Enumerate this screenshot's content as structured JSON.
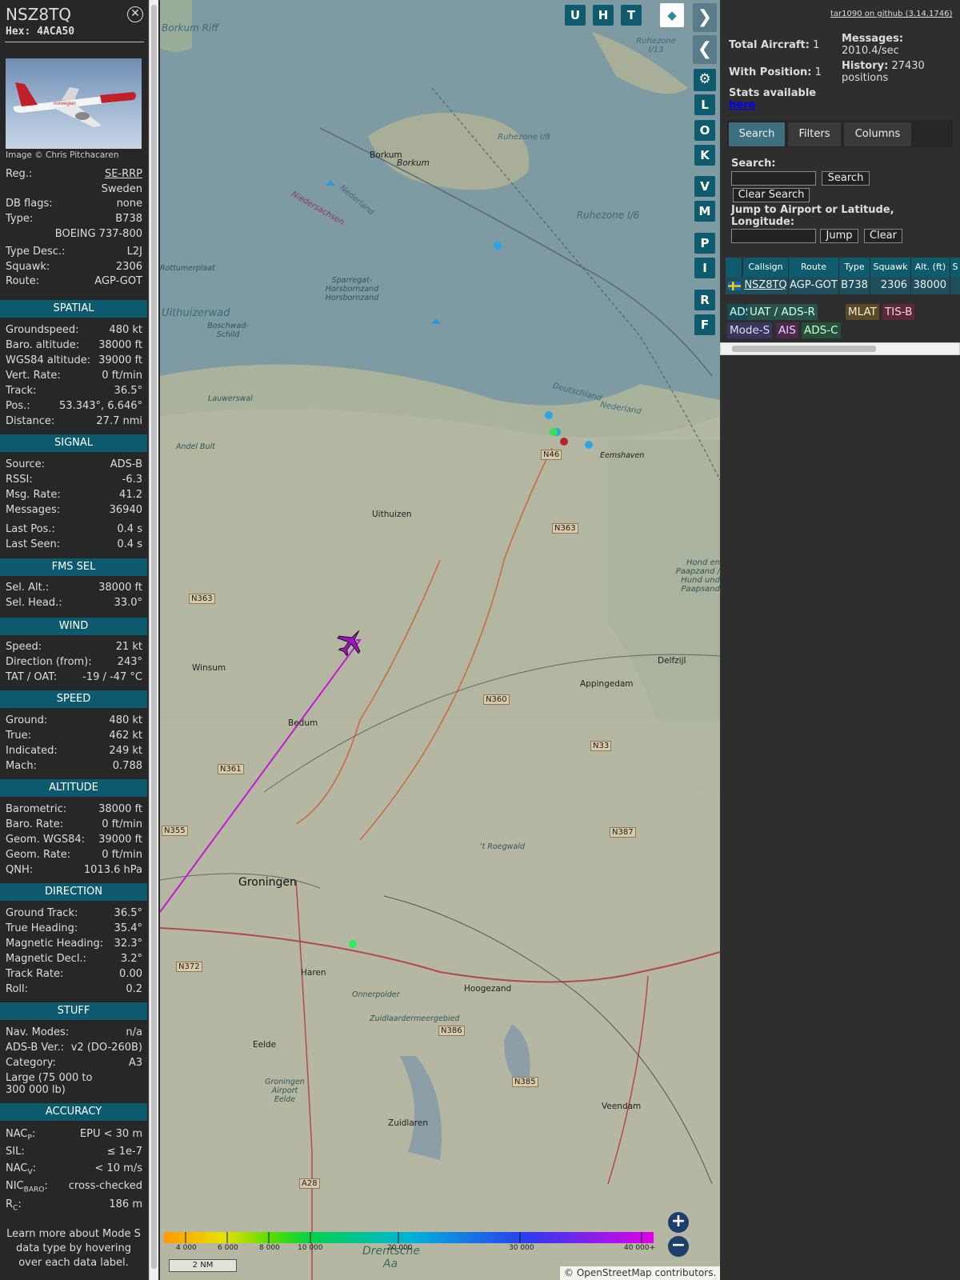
{
  "details": {
    "callsign": "NSZ8TQ",
    "hex": "Hex: 4ACA50",
    "photo_credit": "Image © Chris Pitchacaren",
    "basic": [
      {
        "k": "Reg.:",
        "v": "SE-RRP"
      },
      {
        "k": "",
        "v": "Sweden"
      },
      {
        "k": "DB flags:",
        "v": "none"
      },
      {
        "k": "Type:",
        "v": "B738"
      },
      {
        "k": "",
        "v": "BOEING 737-800"
      },
      {
        "k": "Type Desc.:",
        "v": "L2J"
      },
      {
        "k": "Squawk:",
        "v": "2306"
      },
      {
        "k": "Route:",
        "v": "AGP-GOT"
      }
    ],
    "spatial": {
      "title": "SPATIAL",
      "rows": [
        {
          "k": "Groundspeed:",
          "v": "480 kt"
        },
        {
          "k": "Baro. altitude:",
          "v": "38000 ft"
        },
        {
          "k": "WGS84 altitude:",
          "v": "39000 ft"
        },
        {
          "k": "Vert. Rate:",
          "v": "0 ft/min"
        },
        {
          "k": "Track:",
          "v": "36.5°"
        },
        {
          "k": "Pos.:",
          "v": "53.343°, 6.646°"
        },
        {
          "k": "Distance:",
          "v": "27.7 nmi"
        }
      ]
    },
    "signal": {
      "title": "SIGNAL",
      "rows": [
        {
          "k": "Source:",
          "v": "ADS-B"
        },
        {
          "k": "RSSI:",
          "v": "-6.3"
        },
        {
          "k": "Msg. Rate:",
          "v": "41.2"
        },
        {
          "k": "Messages:",
          "v": "36940"
        },
        {
          "k": "Last Pos.:",
          "v": "0.4 s"
        },
        {
          "k": "Last Seen:",
          "v": "0.4 s"
        }
      ]
    },
    "fms": {
      "title": "FMS SEL",
      "rows": [
        {
          "k": "Sel. Alt.:",
          "v": "38000 ft"
        },
        {
          "k": "Sel. Head.:",
          "v": "33.0°"
        }
      ]
    },
    "wind": {
      "title": "WIND",
      "rows": [
        {
          "k": "Speed:",
          "v": "21 kt"
        },
        {
          "k": "Direction (from):",
          "v": "243°"
        },
        {
          "k": "TAT / OAT:",
          "v": "-19 / -47 °C"
        }
      ]
    },
    "speed": {
      "title": "SPEED",
      "rows": [
        {
          "k": "Ground:",
          "v": "480 kt"
        },
        {
          "k": "True:",
          "v": "462 kt"
        },
        {
          "k": "Indicated:",
          "v": "249 kt"
        },
        {
          "k": "Mach:",
          "v": "0.788"
        }
      ]
    },
    "altitude": {
      "title": "ALTITUDE",
      "rows": [
        {
          "k": "Barometric:",
          "v": "38000 ft"
        },
        {
          "k": "Baro. Rate:",
          "v": "0 ft/min"
        },
        {
          "k": "Geom. WGS84:",
          "v": "39000 ft"
        },
        {
          "k": "Geom. Rate:",
          "v": "0 ft/min"
        },
        {
          "k": "QNH:",
          "v": "1013.6 hPa"
        }
      ]
    },
    "direction": {
      "title": "DIRECTION",
      "rows": [
        {
          "k": "Ground Track:",
          "v": "36.5°"
        },
        {
          "k": "True Heading:",
          "v": "35.4°"
        },
        {
          "k": "Magnetic Heading:",
          "v": "32.3°"
        },
        {
          "k": "Magnetic Decl.:",
          "v": "3.2°"
        },
        {
          "k": "Track Rate:",
          "v": "0.00"
        },
        {
          "k": "Roll:",
          "v": "0.2"
        }
      ]
    },
    "stuff": {
      "title": "STUFF",
      "rows": [
        {
          "k": "Nav. Modes:",
          "v": "n/a"
        },
        {
          "k": "ADS-B Ver.:",
          "v": "v2 (DO-260B)"
        },
        {
          "k": "Category:",
          "v": "A3"
        }
      ],
      "category_desc": "Large (75 000 to 300 000 lb)"
    },
    "accuracy": {
      "title": "ACCURACY",
      "rows": [
        {
          "k": "NAC",
          "sub": "P",
          "v": "EPU < 30 m"
        },
        {
          "k": "SIL:",
          "sub": "",
          "v": "≤ 1e-7"
        },
        {
          "k": "NAC",
          "sub": "V",
          "v": "< 10 m/s"
        },
        {
          "k": "NIC",
          "sub": "BARO",
          "v": "cross-checked"
        },
        {
          "k": "R",
          "sub": "C",
          "v": "186 m"
        }
      ]
    },
    "footer_note": "Learn more about Mode S data type by hovering over each data label."
  },
  "map_buttons": {
    "top": [
      "U",
      "H",
      "T"
    ],
    "side": [
      "L",
      "O",
      "K",
      "V",
      "M",
      "P",
      "I",
      "R",
      "F"
    ]
  },
  "stats": {
    "total_label": "Total Aircraft:",
    "total": "1",
    "pos_label": "With Position:",
    "pos": "1",
    "msgs_label": "Messages:",
    "msgs": "2010.4/sec",
    "hist_label": "History:",
    "hist": "27430 positions",
    "stats_label": "Stats available",
    "stats_link": "here",
    "version": "tar1090 on github (3.14.1746)"
  },
  "tabs": [
    "Search",
    "Filters",
    "Columns"
  ],
  "search": {
    "label": "Search:",
    "btn": "Search",
    "clear": "Clear Search",
    "jump_label": "Jump to Airport or Latitude, Longitude:",
    "jump": "Jump",
    "jump_clear": "Clear"
  },
  "table": {
    "headers": [
      "",
      "Callsign",
      "Route",
      "Type",
      "Squawk",
      "Alt. (ft)",
      "S"
    ],
    "row": {
      "callsign": "NSZ8TQ",
      "route": "AGP-GOT",
      "type": "B738",
      "squawk": "2306",
      "alt": "38000"
    }
  },
  "sources": [
    {
      "label": "ADS-B",
      "color": "#1b4a57",
      "fg": "#cfe"
    },
    {
      "label": "UAT / ADS-R",
      "color": "#28524a",
      "fg": "#cfe"
    },
    {
      "label": "MLAT",
      "color": "#5a4a2a",
      "fg": "#eec"
    },
    {
      "label": "TIS-B",
      "color": "#5a2a3a",
      "fg": "#fcd"
    },
    {
      "label": "Mode-S",
      "color": "#37365e",
      "fg": "#dde"
    },
    {
      "label": "AIS",
      "color": "#4a2c4a",
      "fg": "#ecf"
    },
    {
      "label": "ADS-C",
      "color": "#26503a",
      "fg": "#cfd"
    }
  ],
  "map": {
    "places": [
      "Borkum",
      "Borkum",
      "Uithuizen",
      "Winsum",
      "Bedum",
      "Appingedam",
      "Delfzijl",
      "Groningen",
      "Haren",
      "Hoogezand",
      "Eelde",
      "Zuidlaren",
      "Veendam",
      "Eemshaven",
      "Onnerpolder",
      "Zuidlaardermeergebied",
      "Groningen Airport Eelde",
      "Rottumerplaat",
      "Lauwerswal",
      "Andel Bult",
      "Sparregat- Horsbornzand Horsbornzand",
      "Hond en Paapzand / Hund und Paapsand",
      "'t Roegwald",
      "Boschwad- Schild"
    ],
    "water": [
      "Borkum Riff",
      "Uithuizerwad",
      "Ruhezone I/6",
      "Ruhezone I/8",
      "Ruhezone I/13",
      "Drentsche Aa",
      "Nederland",
      "Niedersachsen",
      "Deutschland",
      "Nederland"
    ],
    "roads": [
      "N46",
      "N363",
      "N363",
      "N360",
      "N33",
      "N361",
      "N355",
      "N387",
      "N372",
      "N386",
      "N385",
      "A28"
    ],
    "scale_ticks": [
      "4 000",
      "6 000",
      "8 000",
      "10 000",
      "20 000",
      "30 000",
      "40 000+"
    ],
    "scale": "2 NM",
    "attribution": "© OpenStreetMap contributors."
  }
}
